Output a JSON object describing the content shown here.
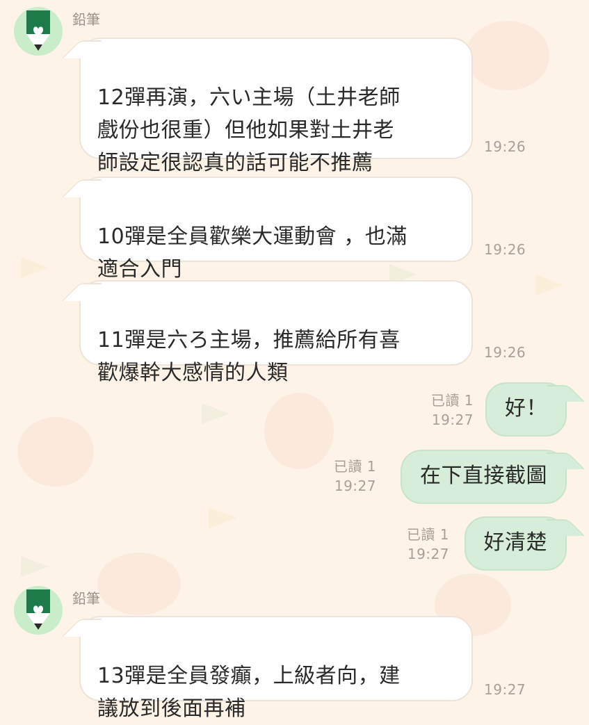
{
  "sender": {
    "name": "鉛筆",
    "avatar_icon": "pencil-icon",
    "avatar_color": "#c9ecc9"
  },
  "messages": [
    {
      "type": "incoming",
      "text": "12彈再演，六い主場（土井老師\n戲份也很重）但他如果對土井老\n師設定很認真的話可能不推薦",
      "time": "19:26"
    },
    {
      "type": "incoming",
      "text": "10彈是全員歡樂大運動會 ，也滿\n適合入門",
      "time": "19:26"
    },
    {
      "type": "incoming",
      "text": "11彈是六ろ主場，推薦給所有喜\n歡爆幹大感情的人類",
      "time": "19:26"
    },
    {
      "type": "outgoing",
      "text": "好！",
      "read": "已讀 1",
      "time": "19:27"
    },
    {
      "type": "outgoing",
      "text": "在下直接截圖",
      "read": "已讀 1",
      "time": "19:27"
    },
    {
      "type": "outgoing",
      "text": "好清楚",
      "read": "已讀 1",
      "time": "19:27"
    },
    {
      "type": "incoming",
      "text": "13彈是全員發癲，上級者向，建\n議放到後面再補",
      "time": "19:27"
    }
  ],
  "colors": {
    "background": "#fdf3e6",
    "outgoing_bubble": "#d6eed9",
    "incoming_bubble": "#ffffff",
    "pencil_green": "#1f7a4a"
  }
}
